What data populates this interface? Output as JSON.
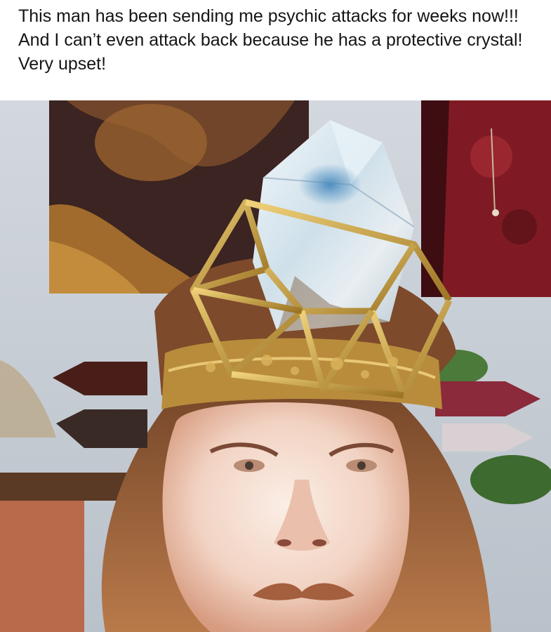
{
  "post": {
    "caption": "This man has been sending me psychic attacks for weeks now!!! And I can’t even attack back because he has a protective crystal! Very upset!"
  },
  "photo": {
    "palette": {
      "wall": "#c9cfd6",
      "tapestry_dark": "#3a2420",
      "tapestry_gold": "#a0662c",
      "red_cloth": "#8a1c26",
      "crystal": "#d8e6ef",
      "crystal_blue": "#6fa6c6",
      "gold_frame": "#caa24a",
      "skin": "#f3d6c8",
      "hair": "#8a5634"
    }
  }
}
